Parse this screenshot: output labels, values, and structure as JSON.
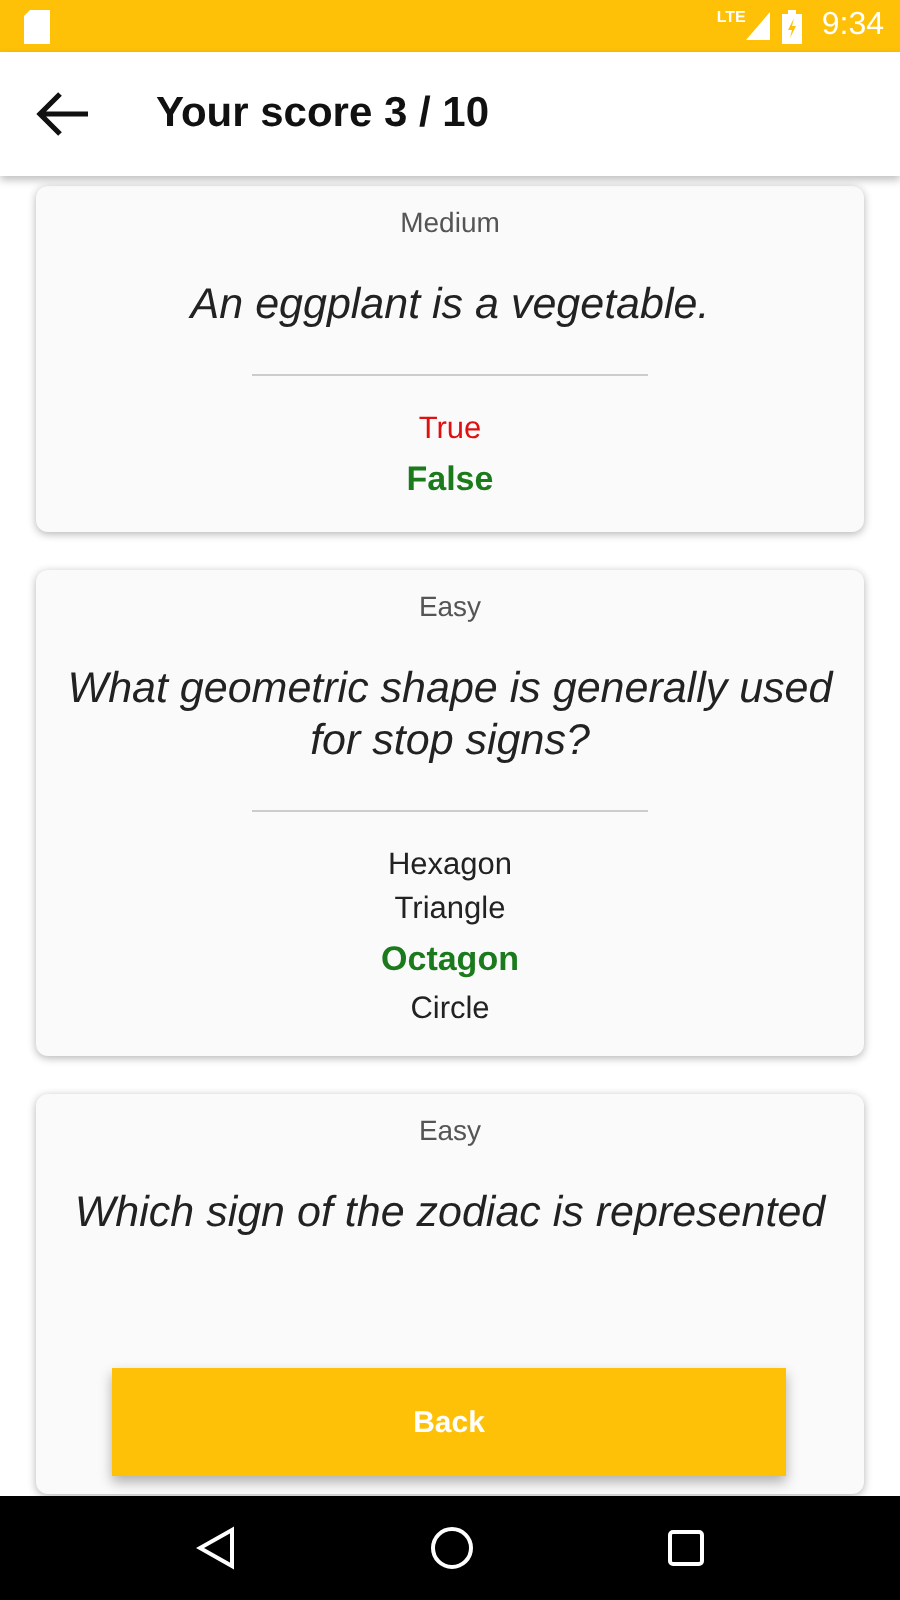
{
  "status_bar": {
    "time": "9:34",
    "network": "LTE"
  },
  "app_bar": {
    "title": "Your score 3 / 10"
  },
  "questions": [
    {
      "difficulty": "Medium",
      "question": "An eggplant is a vegetable.",
      "answers": [
        {
          "text": "True",
          "kind": "wrong"
        },
        {
          "text": "False",
          "kind": "correct"
        }
      ]
    },
    {
      "difficulty": "Easy",
      "question": "What geometric shape is generally used for stop signs?",
      "answers": [
        {
          "text": "Hexagon",
          "kind": "plain"
        },
        {
          "text": "Triangle",
          "kind": "plain"
        },
        {
          "text": "Octagon",
          "kind": "correct"
        },
        {
          "text": "Circle",
          "kind": "plain"
        }
      ]
    },
    {
      "difficulty": "Easy",
      "question": "Which sign of the zodiac is represented"
    }
  ],
  "back_button": {
    "label": "Back"
  }
}
